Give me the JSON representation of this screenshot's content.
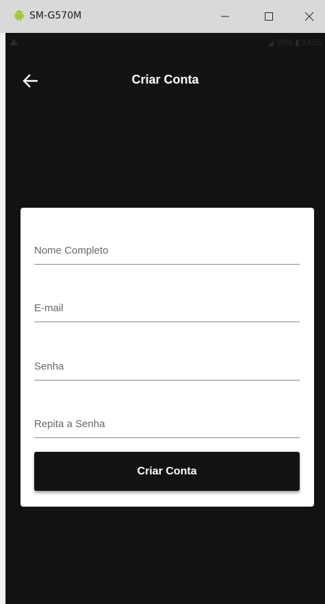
{
  "window": {
    "title": "SM-G570M",
    "minimize_glyph": "—",
    "maximize_glyph": "☐",
    "close_glyph": "✕"
  },
  "status_bar": {
    "text": "◢ 90% ▮ 14:55"
  },
  "app_bar": {
    "title": "Criar Conta"
  },
  "form": {
    "fields": [
      {
        "placeholder": "Nome Completo",
        "value": ""
      },
      {
        "placeholder": "E-mail",
        "value": ""
      },
      {
        "placeholder": "Senha",
        "value": ""
      },
      {
        "placeholder": "Repita a Senha",
        "value": ""
      }
    ],
    "submit_label": "Criar Conta"
  },
  "colors": {
    "background": "#121212",
    "card": "#ffffff",
    "button": "#121212",
    "android_green": "#a4c639"
  }
}
